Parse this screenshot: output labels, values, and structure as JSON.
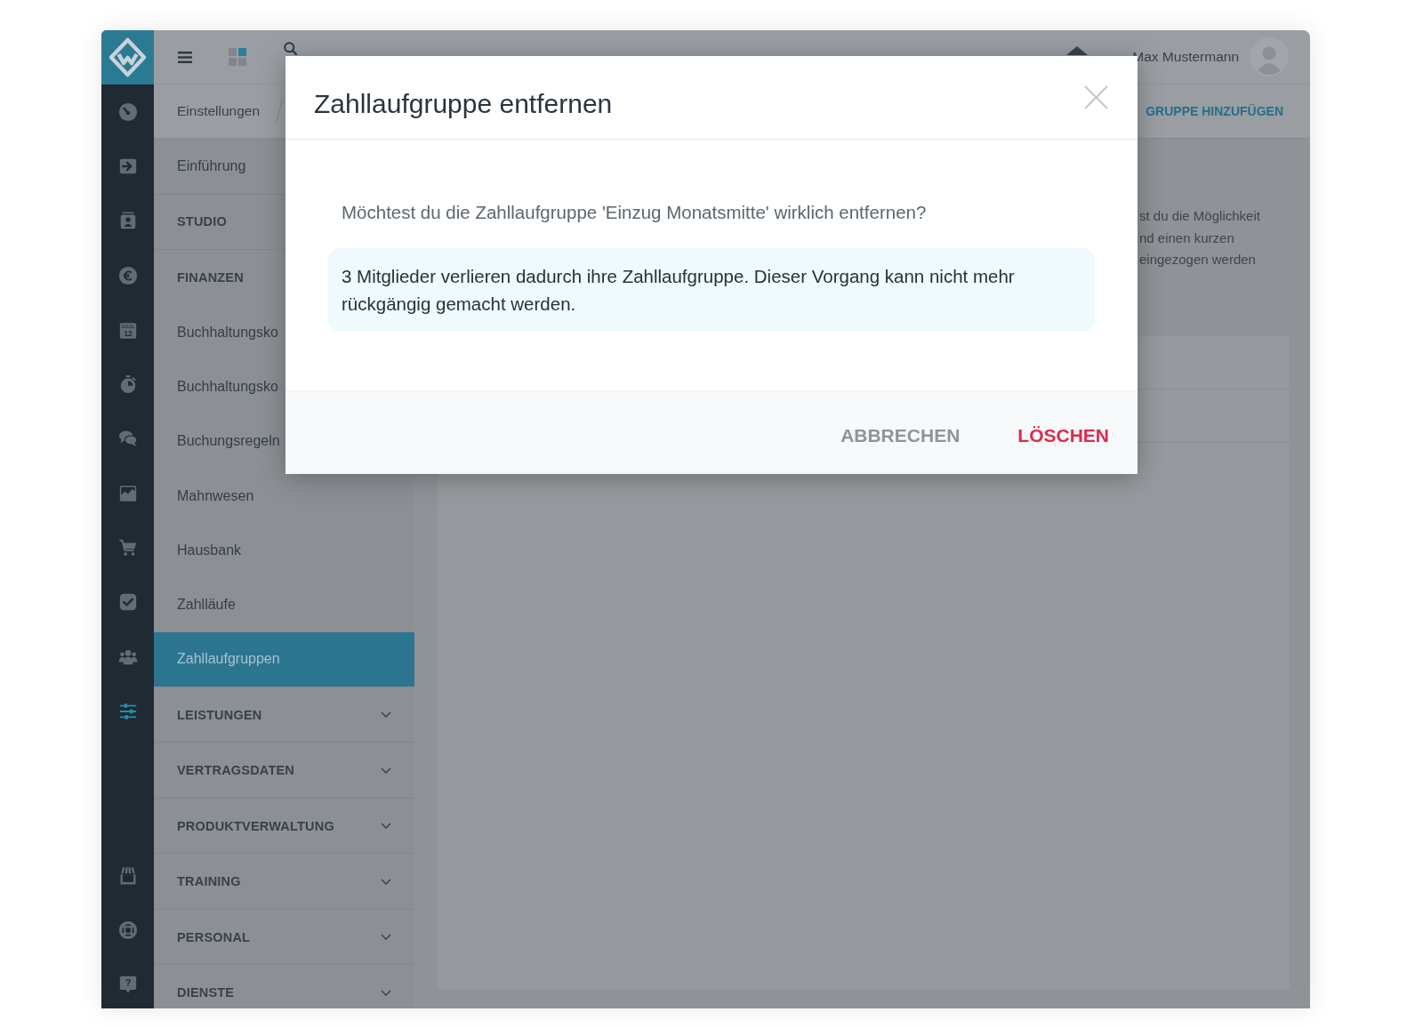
{
  "icon_rail": {
    "top_items": [
      {
        "selected": false
      },
      {
        "selected": false
      },
      {
        "selected": false
      },
      {
        "selected": false
      },
      {
        "selected": false,
        "text": "12"
      },
      {
        "selected": false
      },
      {
        "selected": false
      },
      {
        "selected": false
      },
      {
        "selected": false
      },
      {
        "selected": false
      },
      {
        "selected": false
      },
      {
        "selected": true
      }
    ],
    "bottom_items": [
      {
        "selected": false
      },
      {
        "selected": false
      },
      {
        "selected": false,
        "text": "?"
      }
    ]
  },
  "top_bar": {
    "user_name": "Max Mustermann"
  },
  "toolbar": {
    "breadcrumb": [
      {
        "label": "Einstellungen"
      }
    ],
    "action": "GRUPPE HINZUFÜGEN"
  },
  "sidebar": {
    "items": [
      {
        "kind": "link",
        "label": "Einführung",
        "selected": false
      },
      {
        "kind": "group",
        "label": "STUDIO"
      },
      {
        "kind": "group",
        "label": "FINANZEN",
        "children": [
          {
            "kind": "link",
            "label": "Buchhaltungsko",
            "selected": false
          },
          {
            "kind": "link",
            "label": "Buchhaltungsko",
            "selected": false
          },
          {
            "kind": "link",
            "label": "Buchungsregeln",
            "selected": false
          },
          {
            "kind": "link",
            "label": "Mahnwesen",
            "selected": false
          },
          {
            "kind": "link",
            "label": "Hausbank",
            "selected": false
          },
          {
            "kind": "link",
            "label": "Zahlläufe",
            "selected": false
          },
          {
            "kind": "link",
            "label": "Zahllaufgruppen",
            "selected": true
          }
        ]
      },
      {
        "kind": "group",
        "label": "LEISTUNGEN",
        "expanded": false
      },
      {
        "kind": "group",
        "label": "VERTRAGSDATEN",
        "expanded": false
      },
      {
        "kind": "group",
        "label": "PRODUKTVERWALTUNG",
        "expanded": false
      },
      {
        "kind": "group",
        "label": "TRAINING",
        "expanded": false
      },
      {
        "kind": "group",
        "label": "PERSONAL",
        "expanded": false
      },
      {
        "kind": "group",
        "label": "DIENSTE",
        "expanded": false
      }
    ]
  },
  "content": {
    "description_lines": [
      "st du die Möglichkeit",
      "nd einen kurzen",
      "eingezogen werden"
    ]
  },
  "dialog": {
    "title": "Zahllaufgruppe entfernen",
    "question": "Möchtest du die Zahllaufgruppe 'Einzug Monatsmitte' wirklich entfernen?",
    "warning": "3 Mitglieder verlieren dadurch ihre Zahllaufgruppe. Dieser Vorgang kann nicht mehr rückgängig gemacht werden.",
    "buttons": [
      {
        "kind": "secondary",
        "label": "ABBRECHEN"
      },
      {
        "kind": "danger",
        "label": "LÖSCHEN"
      }
    ]
  }
}
